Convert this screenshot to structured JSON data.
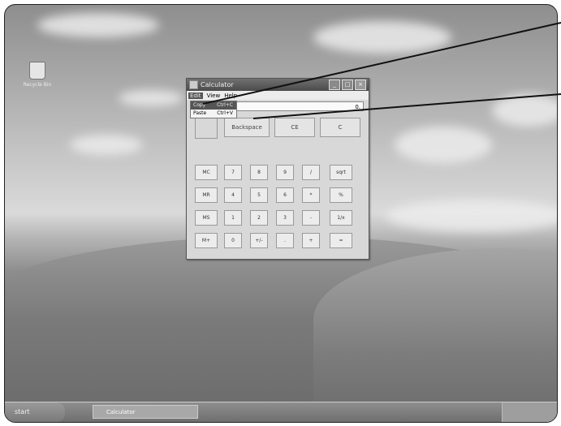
{
  "desktop": {
    "icon_label": "Recycle Bin"
  },
  "window": {
    "title": "Calculator",
    "menu": [
      "Edit",
      "View",
      "Help"
    ],
    "edit_menu": [
      {
        "label": "Copy",
        "shortcut": "Ctrl+C"
      },
      {
        "label": "Paste",
        "shortcut": "Ctrl+V"
      }
    ],
    "display_value": "0.",
    "backspace": "Backspace",
    "ce": "CE",
    "c": "C",
    "keys": [
      [
        "MC",
        "7",
        "8",
        "9",
        "/",
        "sqrt"
      ],
      [
        "MR",
        "4",
        "5",
        "6",
        "*",
        "%"
      ],
      [
        "MS",
        "1",
        "2",
        "3",
        "-",
        "1/x"
      ],
      [
        "M+",
        "0",
        "+/-",
        ".",
        "+",
        "="
      ]
    ]
  },
  "taskbar": {
    "start": "start",
    "task": "Calculator"
  }
}
